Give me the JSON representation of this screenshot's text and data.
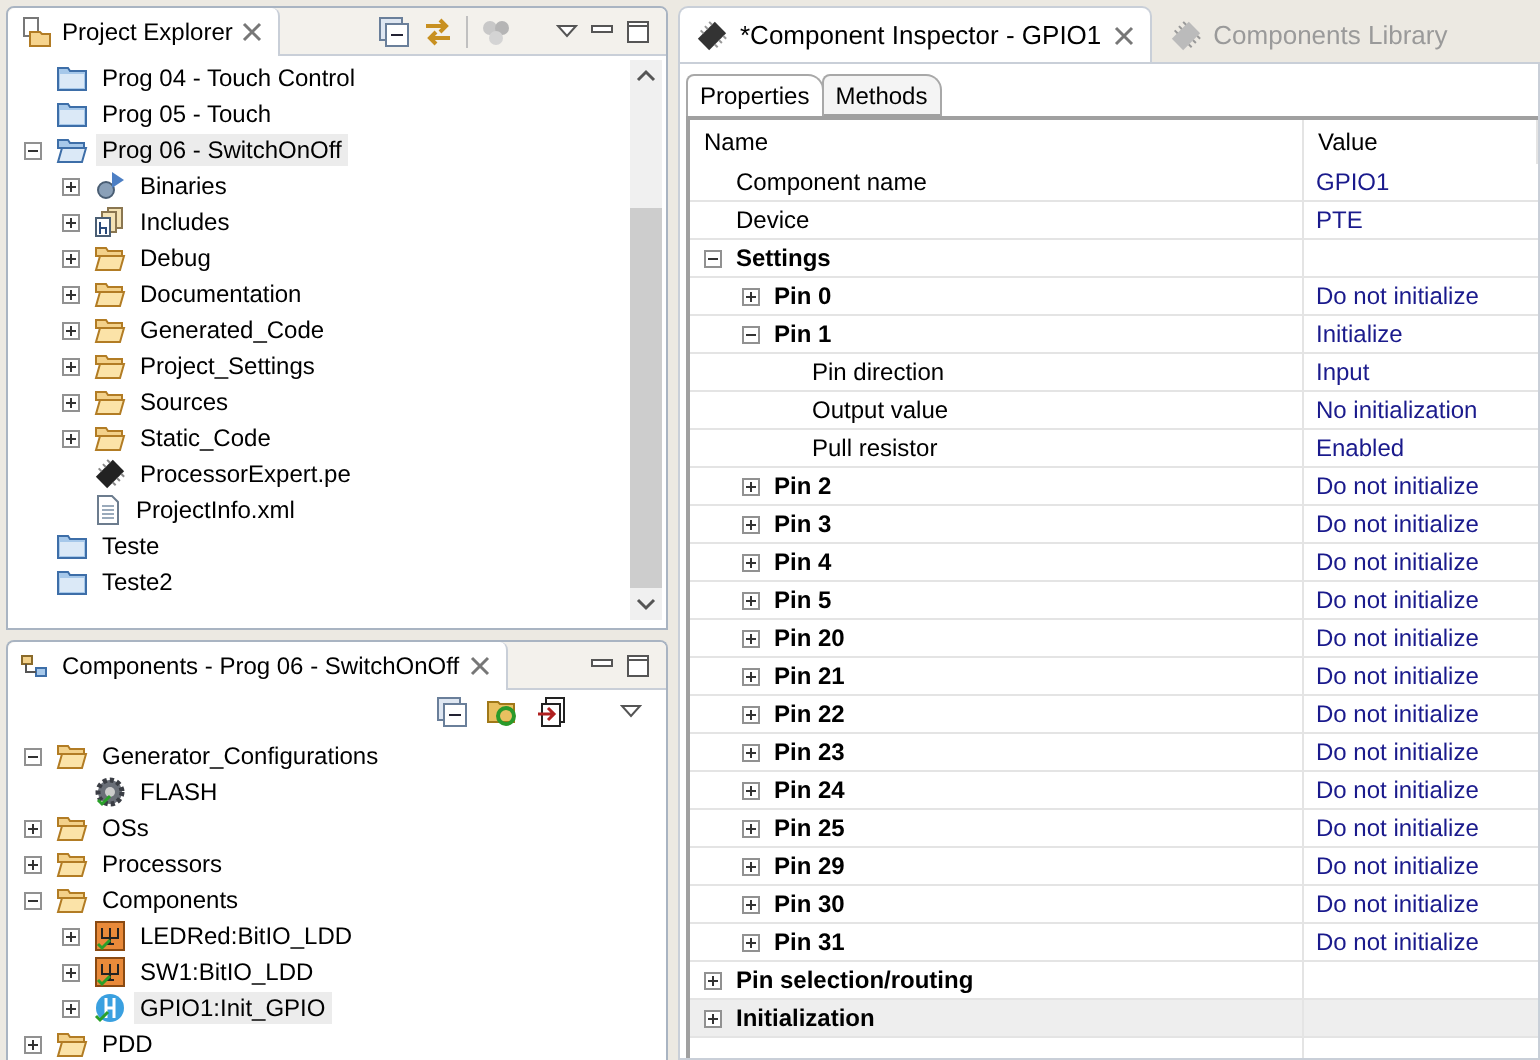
{
  "project_explorer": {
    "title": "Project Explorer",
    "tree": [
      {
        "label": "Prog 04 - Touch Control",
        "kind": "project",
        "selected": false
      },
      {
        "label": "Prog 05 - Touch",
        "kind": "project",
        "selected": false
      },
      {
        "label": "Prog 06 - SwitchOnOff",
        "kind": "open_project",
        "expanded": true,
        "selected": true,
        "children": [
          {
            "label": "Binaries",
            "kind": "binaries",
            "expanded": false,
            "selected": false
          },
          {
            "label": "Includes",
            "kind": "includes",
            "expanded": false,
            "selected": false
          },
          {
            "label": "Debug",
            "kind": "folder",
            "expanded": false,
            "selected": false
          },
          {
            "label": "Documentation",
            "kind": "folder",
            "expanded": false,
            "selected": false
          },
          {
            "label": "Generated_Code",
            "kind": "folder",
            "expanded": false,
            "selected": false
          },
          {
            "label": "Project_Settings",
            "kind": "folder",
            "expanded": false,
            "selected": false
          },
          {
            "label": "Sources",
            "kind": "folder",
            "expanded": false,
            "selected": false
          },
          {
            "label": "Static_Code",
            "kind": "folder",
            "expanded": false,
            "selected": false
          },
          {
            "label": "ProcessorExpert.pe",
            "kind": "chip",
            "selected": false
          },
          {
            "label": "ProjectInfo.xml",
            "kind": "file",
            "selected": false
          }
        ]
      },
      {
        "label": "Teste",
        "kind": "project",
        "selected": false
      },
      {
        "label": "Teste2",
        "kind": "project",
        "selected": false
      }
    ]
  },
  "components_view": {
    "title": "Components - Prog 06 - SwitchOnOff",
    "tree": [
      {
        "label": "Generator_Configurations",
        "kind": "folder",
        "expanded": true,
        "selected": false,
        "children": [
          {
            "label": "FLASH",
            "kind": "gear",
            "selected": false
          }
        ]
      },
      {
        "label": "OSs",
        "kind": "folder",
        "expanded": false,
        "selected": false
      },
      {
        "label": "Processors",
        "kind": "folder",
        "expanded": false,
        "selected": false
      },
      {
        "label": "Components",
        "kind": "folder",
        "expanded": true,
        "selected": false,
        "children": [
          {
            "label": "LEDRed:BitIO_LDD",
            "kind": "component",
            "expanded": false,
            "selected": false
          },
          {
            "label": "SW1:BitIO_LDD",
            "kind": "component",
            "expanded": false,
            "selected": false
          },
          {
            "label": "GPIO1:Init_GPIO",
            "kind": "gpio",
            "expanded": false,
            "selected": true
          }
        ]
      },
      {
        "label": "PDD",
        "kind": "folder",
        "expanded": false,
        "selected": false
      }
    ]
  },
  "editor_tabs": [
    {
      "label": "*Component Inspector - GPIO1",
      "selected": true
    },
    {
      "label": "Components Library",
      "selected": false
    }
  ],
  "inspector": {
    "tabs": [
      {
        "label": "Properties",
        "selected": true
      },
      {
        "label": "Methods",
        "selected": false
      }
    ],
    "columns": [
      "Name",
      "Value"
    ],
    "rows": [
      {
        "name": "Component name",
        "value": "GPIO1",
        "kind": "property",
        "selected": false
      },
      {
        "name": "Device",
        "value": "PTE",
        "kind": "property",
        "selected": false
      },
      {
        "name": "Settings",
        "kind": "group",
        "expanded": true,
        "selected": false,
        "children": [
          {
            "name": "Pin 0",
            "value": "Do not initialize",
            "kind": "group",
            "expanded": false,
            "selected": false
          },
          {
            "name": "Pin 1",
            "value": "Initialize",
            "kind": "group",
            "expanded": true,
            "selected": false,
            "children": [
              {
                "name": "Pin direction",
                "value": "Input",
                "kind": "property",
                "selected": false
              },
              {
                "name": "Output value",
                "value": "No initialization",
                "kind": "property",
                "selected": false
              },
              {
                "name": "Pull resistor",
                "value": "Enabled",
                "kind": "property",
                "selected": false
              }
            ]
          },
          {
            "name": "Pin 2",
            "value": "Do not initialize",
            "kind": "group",
            "expanded": false,
            "selected": false
          },
          {
            "name": "Pin 3",
            "value": "Do not initialize",
            "kind": "group",
            "expanded": false,
            "selected": false
          },
          {
            "name": "Pin 4",
            "value": "Do not initialize",
            "kind": "group",
            "expanded": false,
            "selected": false
          },
          {
            "name": "Pin 5",
            "value": "Do not initialize",
            "kind": "group",
            "expanded": false,
            "selected": false
          },
          {
            "name": "Pin 20",
            "value": "Do not initialize",
            "kind": "group",
            "expanded": false,
            "selected": false
          },
          {
            "name": "Pin 21",
            "value": "Do not initialize",
            "kind": "group",
            "expanded": false,
            "selected": false
          },
          {
            "name": "Pin 22",
            "value": "Do not initialize",
            "kind": "group",
            "expanded": false,
            "selected": false
          },
          {
            "name": "Pin 23",
            "value": "Do not initialize",
            "kind": "group",
            "expanded": false,
            "selected": false
          },
          {
            "name": "Pin 24",
            "value": "Do not initialize",
            "kind": "group",
            "expanded": false,
            "selected": false
          },
          {
            "name": "Pin 25",
            "value": "Do not initialize",
            "kind": "group",
            "expanded": false,
            "selected": false
          },
          {
            "name": "Pin 29",
            "value": "Do not initialize",
            "kind": "group",
            "expanded": false,
            "selected": false
          },
          {
            "name": "Pin 30",
            "value": "Do not initialize",
            "kind": "group",
            "expanded": false,
            "selected": false
          },
          {
            "name": "Pin 31",
            "value": "Do not initialize",
            "kind": "group",
            "expanded": false,
            "selected": false
          }
        ]
      },
      {
        "name": "Pin selection/routing",
        "kind": "group",
        "expanded": false,
        "selected": false
      },
      {
        "name": "Initialization",
        "kind": "group",
        "expanded": false,
        "selected": true
      }
    ]
  }
}
